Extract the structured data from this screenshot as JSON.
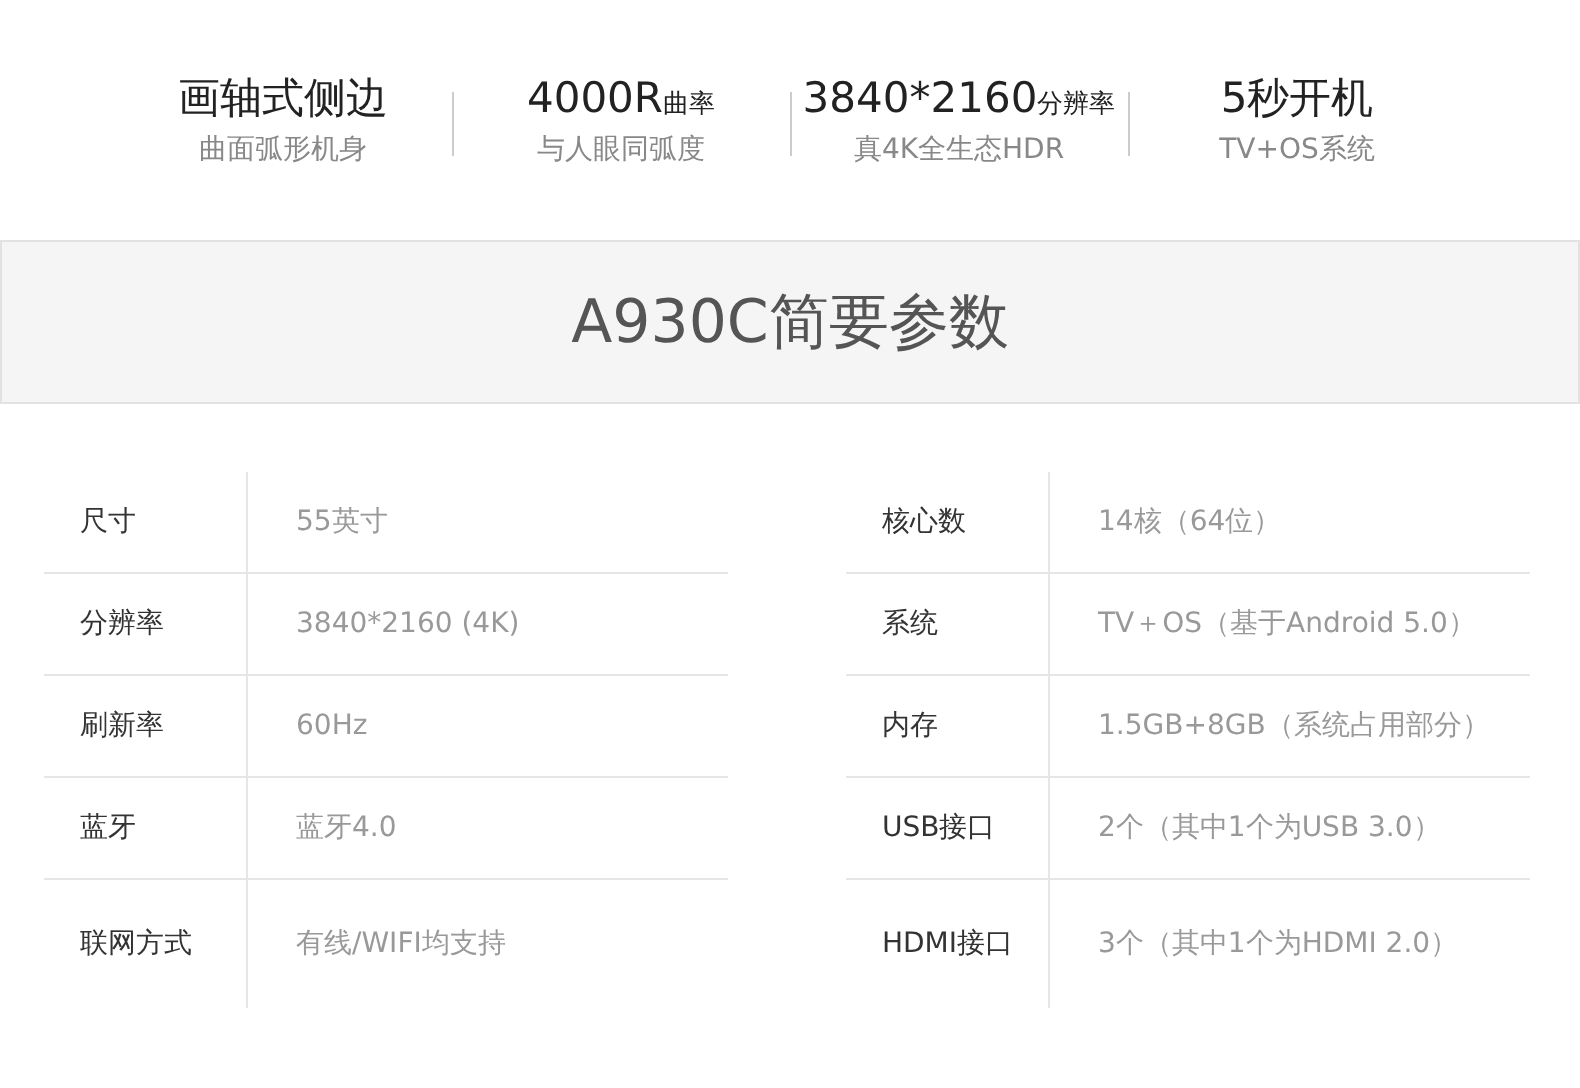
{
  "features": [
    {
      "headline": "画轴式侧边",
      "caption": "曲面弧形机身"
    },
    {
      "headline": "4000R",
      "suffix": "曲率",
      "caption": "与人眼同弧度"
    },
    {
      "headline": "3840*2160",
      "suffix": "分辨率",
      "caption": "真4K全生态HDR"
    },
    {
      "headline": "5秒开机",
      "caption": "TV+OS系统"
    }
  ],
  "section_title": "A930C简要参数",
  "spec_tables": [
    [
      {
        "label": "尺寸",
        "value": "55英寸"
      },
      {
        "label": "分辨率",
        "value": "3840*2160 (4K)"
      },
      {
        "label": "刷新率",
        "value": "60Hz"
      },
      {
        "label": "蓝牙",
        "value": "蓝牙4.0"
      },
      {
        "label": "联网方式",
        "value": "有线/WIFI均支持"
      }
    ],
    [
      {
        "label": "核心数",
        "value": "14核（64位）"
      },
      {
        "label": "系统",
        "value": "TV＋OS（基于Android 5.0）"
      },
      {
        "label": "内存",
        "value": "1.5GB+8GB（系统占用部分）"
      },
      {
        "label": "USB接口",
        "value": "2个（其中1个为USB 3.0）"
      },
      {
        "label": "HDMI接口",
        "value": "3个（其中1个为HDMI 2.0）"
      }
    ]
  ]
}
